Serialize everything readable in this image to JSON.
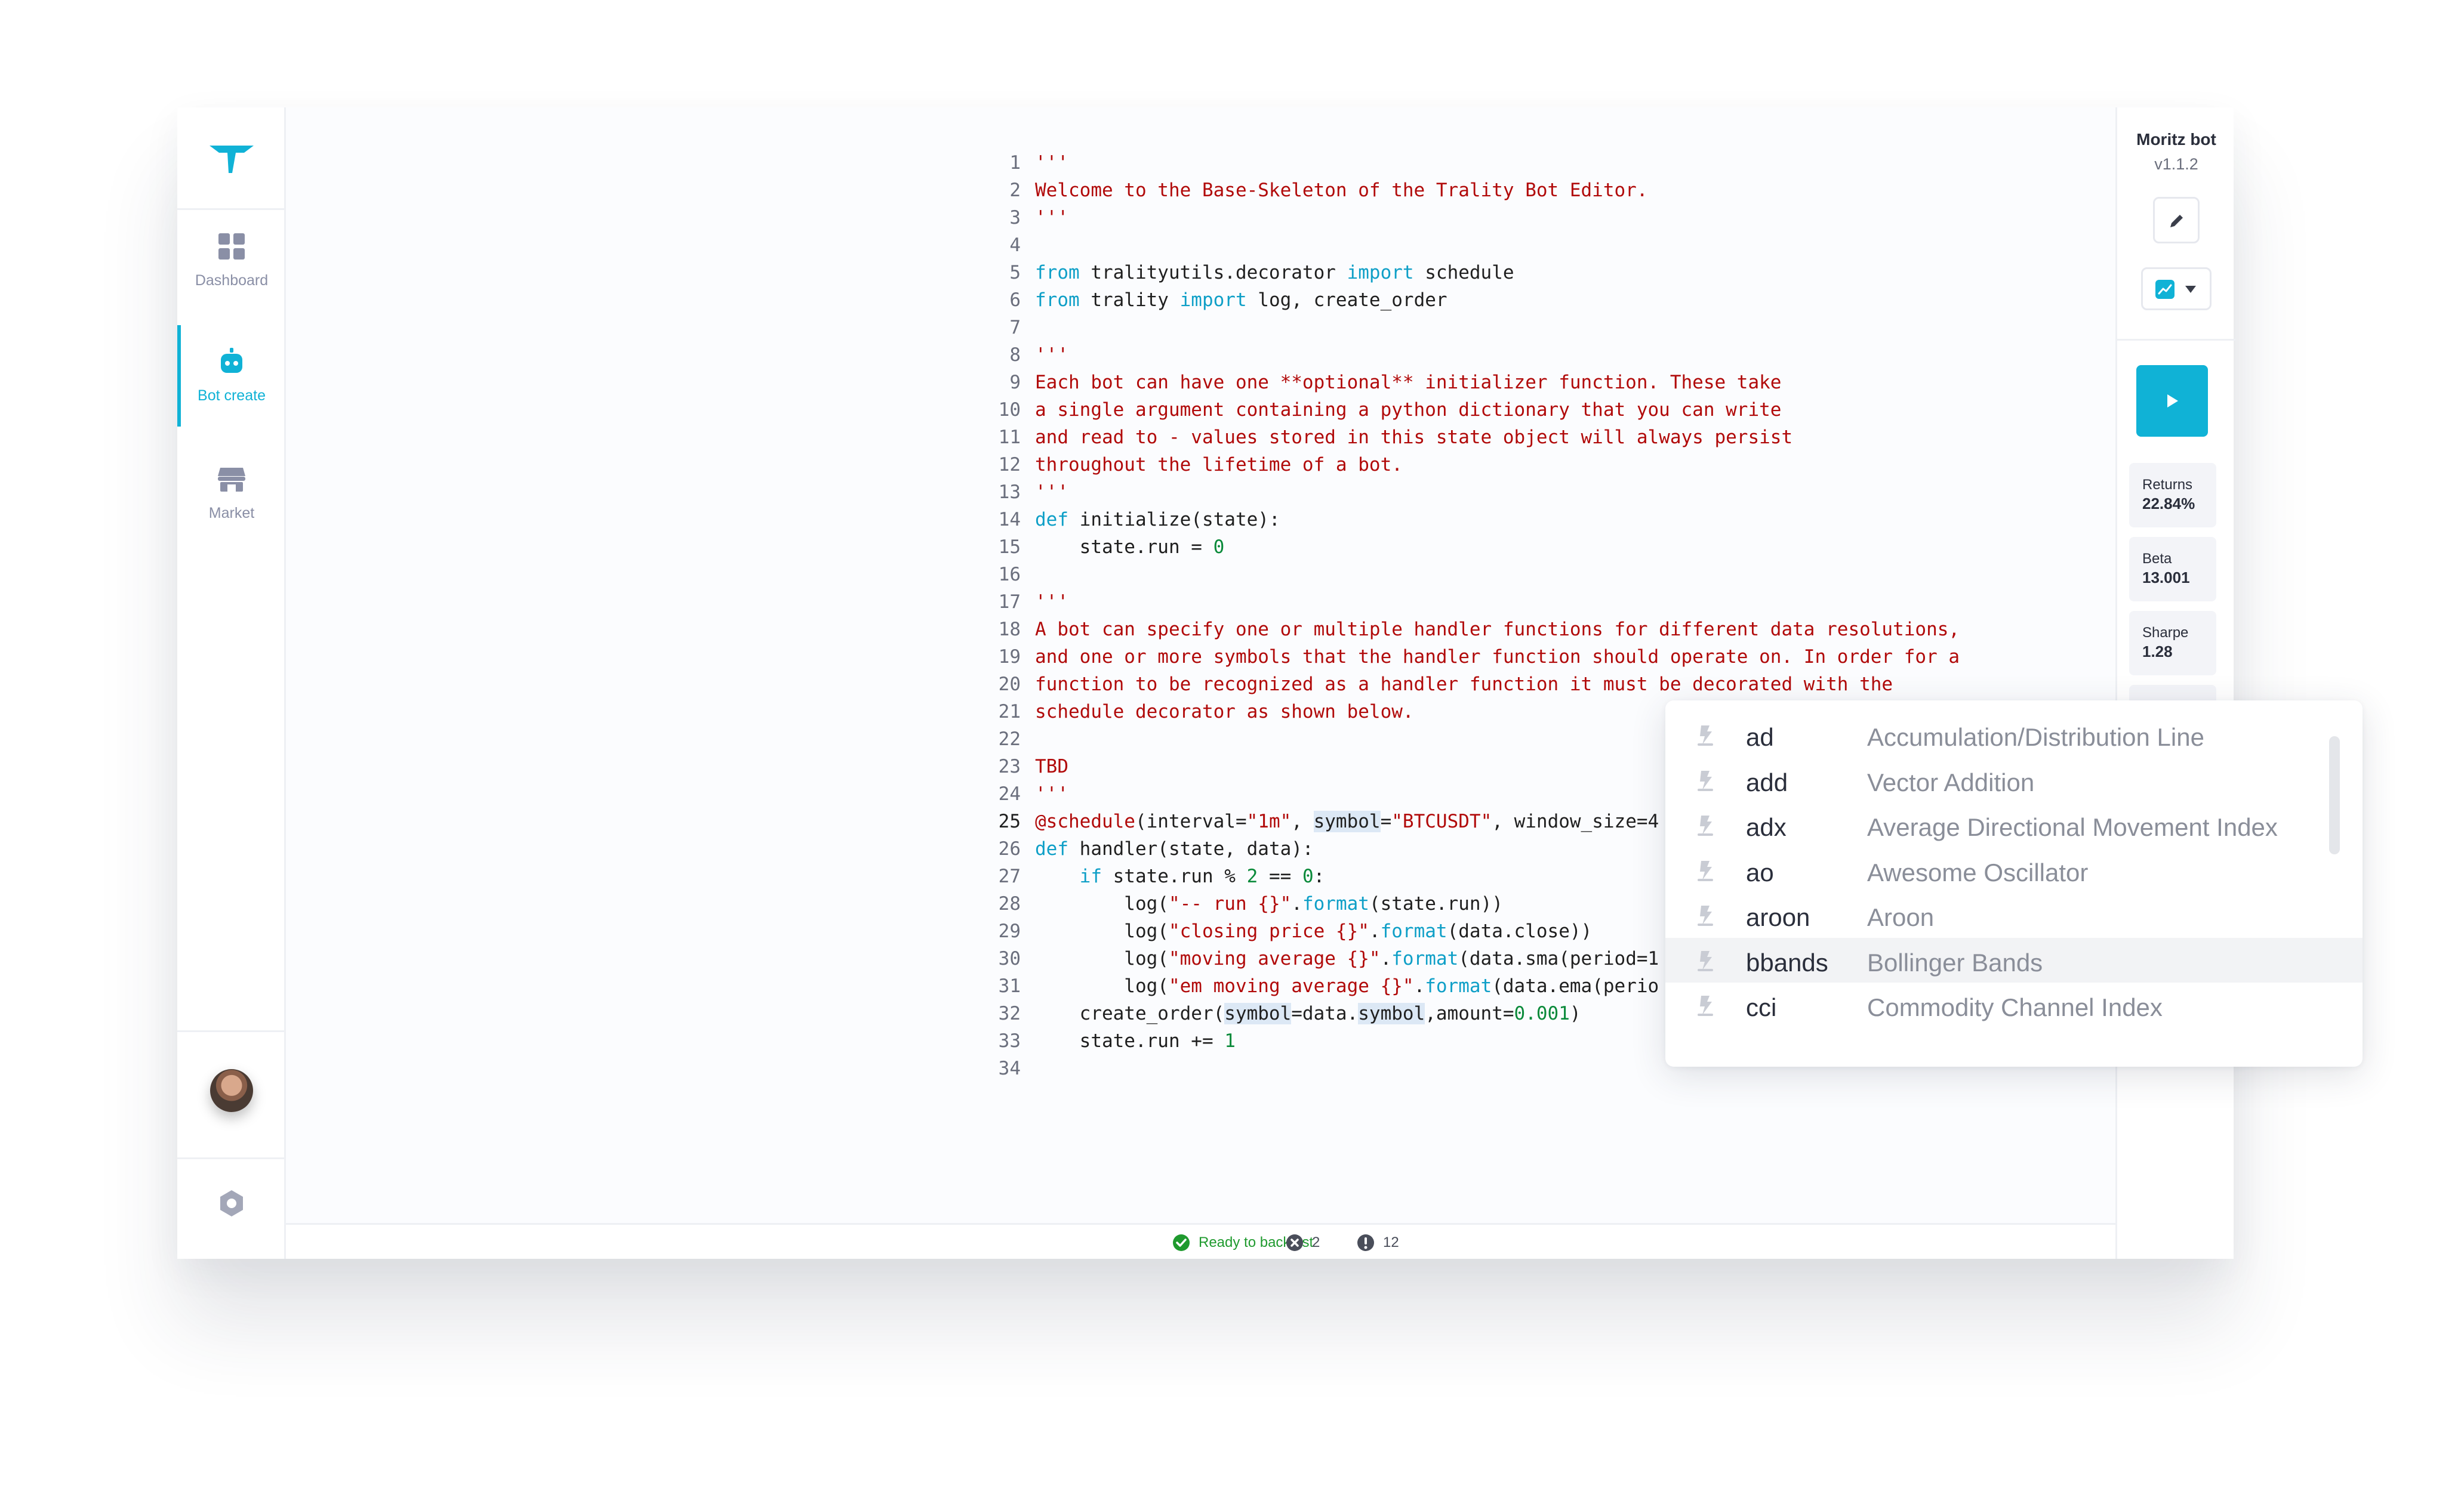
{
  "sidebar": {
    "items": [
      {
        "label": "Dashboard",
        "icon": "grid-icon"
      },
      {
        "label": "Bot create",
        "icon": "robot-icon",
        "active": true
      },
      {
        "label": "Market",
        "icon": "store-icon"
      }
    ]
  },
  "editor": {
    "lines": [
      {
        "n": "1",
        "tokens": [
          {
            "t": "'''",
            "c": "s"
          }
        ]
      },
      {
        "n": "2",
        "tokens": [
          {
            "t": "Welcome to the Base-Skeleton of the Trality Bot Editor.",
            "c": "s"
          }
        ]
      },
      {
        "n": "3",
        "tokens": [
          {
            "t": "'''",
            "c": "s"
          }
        ]
      },
      {
        "n": "4",
        "tokens": []
      },
      {
        "n": "5",
        "tokens": [
          {
            "t": "from",
            "c": "k"
          },
          {
            "t": " tralityutils.decorator "
          },
          {
            "t": "import",
            "c": "k"
          },
          {
            "t": " schedule"
          }
        ]
      },
      {
        "n": "6",
        "tokens": [
          {
            "t": "from",
            "c": "k"
          },
          {
            "t": " trality "
          },
          {
            "t": "import",
            "c": "k"
          },
          {
            "t": " log, create_order"
          }
        ]
      },
      {
        "n": "7",
        "tokens": []
      },
      {
        "n": "8",
        "tokens": [
          {
            "t": "'''",
            "c": "s"
          }
        ]
      },
      {
        "n": "9",
        "tokens": [
          {
            "t": "Each bot can have one **optional** initializer function. These take",
            "c": "s"
          }
        ]
      },
      {
        "n": "10",
        "tokens": [
          {
            "t": "a single argument containing a python dictionary that you can write",
            "c": "s"
          }
        ]
      },
      {
        "n": "11",
        "tokens": [
          {
            "t": "and read to - values stored in this state object will always persist",
            "c": "s"
          }
        ]
      },
      {
        "n": "12",
        "tokens": [
          {
            "t": "throughout the lifetime of a bot.",
            "c": "s"
          }
        ]
      },
      {
        "n": "13",
        "tokens": [
          {
            "t": "'''",
            "c": "s"
          }
        ]
      },
      {
        "n": "14",
        "tokens": [
          {
            "t": "def",
            "c": "k"
          },
          {
            "t": " initialize(state):"
          }
        ]
      },
      {
        "n": "15",
        "tokens": [
          {
            "t": "    state.run = "
          },
          {
            "t": "0",
            "c": "n"
          }
        ]
      },
      {
        "n": "16",
        "tokens": []
      },
      {
        "n": "17",
        "tokens": [
          {
            "t": "'''",
            "c": "s"
          }
        ]
      },
      {
        "n": "18",
        "tokens": [
          {
            "t": "A bot can specify one or multiple handler functions for different data resolutions,",
            "c": "s"
          }
        ]
      },
      {
        "n": "19",
        "tokens": [
          {
            "t": "and one or more symbols that the handler function should operate on. In order for a",
            "c": "s"
          }
        ]
      },
      {
        "n": "20",
        "tokens": [
          {
            "t": "function to be recognized as a handler function it must be decorated with the",
            "c": "s"
          }
        ]
      },
      {
        "n": "21",
        "tokens": [
          {
            "t": "schedule decorator as shown below.",
            "c": "s"
          }
        ]
      },
      {
        "n": "22",
        "tokens": []
      },
      {
        "n": "23",
        "tokens": [
          {
            "t": "TBD",
            "c": "s"
          }
        ]
      },
      {
        "n": "24",
        "tokens": [
          {
            "t": "'''",
            "c": "s"
          }
        ]
      },
      {
        "n": "25",
        "cur": true,
        "tokens": [
          {
            "t": "@schedule",
            "c": "s"
          },
          {
            "t": "(interval="
          },
          {
            "t": "\"1m\"",
            "c": "s"
          },
          {
            "t": ", "
          },
          {
            "t": "symbol",
            "c": "hl"
          },
          {
            "t": "="
          },
          {
            "t": "\"BTCUSDT\"",
            "c": "s"
          },
          {
            "t": ", window_size=4"
          }
        ]
      },
      {
        "n": "26",
        "tokens": [
          {
            "t": "def",
            "c": "k"
          },
          {
            "t": " handler(state, data):"
          }
        ]
      },
      {
        "n": "27",
        "tokens": [
          {
            "t": "    "
          },
          {
            "t": "if",
            "c": "k"
          },
          {
            "t": " state.run % "
          },
          {
            "t": "2",
            "c": "n"
          },
          {
            "t": " == "
          },
          {
            "t": "0",
            "c": "n"
          },
          {
            "t": ":"
          }
        ]
      },
      {
        "n": "28",
        "tokens": [
          {
            "t": "        log("
          },
          {
            "t": "\"-- run {}\"",
            "c": "s"
          },
          {
            "t": "."
          },
          {
            "t": "format",
            "c": "k"
          },
          {
            "t": "(state.run))"
          }
        ]
      },
      {
        "n": "29",
        "tokens": [
          {
            "t": "        log("
          },
          {
            "t": "\"closing price {}\"",
            "c": "s"
          },
          {
            "t": "."
          },
          {
            "t": "format",
            "c": "k"
          },
          {
            "t": "(data.close))"
          }
        ]
      },
      {
        "n": "30",
        "tokens": [
          {
            "t": "        log("
          },
          {
            "t": "\"moving average {}\"",
            "c": "s"
          },
          {
            "t": "."
          },
          {
            "t": "format",
            "c": "k"
          },
          {
            "t": "(data.sma(period=1"
          }
        ]
      },
      {
        "n": "31",
        "tokens": [
          {
            "t": "        log("
          },
          {
            "t": "\"em moving average {}\"",
            "c": "s"
          },
          {
            "t": "."
          },
          {
            "t": "format",
            "c": "k"
          },
          {
            "t": "(data.ema(perio"
          }
        ]
      },
      {
        "n": "32",
        "tokens": [
          {
            "t": "    create_order("
          },
          {
            "t": "symbol",
            "c": "hl"
          },
          {
            "t": "=data."
          },
          {
            "t": "symbol",
            "c": "hl"
          },
          {
            "t": ",amount="
          },
          {
            "t": "0.001",
            "c": "n"
          },
          {
            "t": ")"
          }
        ]
      },
      {
        "n": "33",
        "tokens": [
          {
            "t": "    state.run += "
          },
          {
            "t": "1",
            "c": "n"
          }
        ]
      },
      {
        "n": "34",
        "tokens": []
      }
    ]
  },
  "status": {
    "ready": "Ready to backtest",
    "errors": "2",
    "warnings": "12"
  },
  "panel": {
    "bot_name": "Moritz bot",
    "version": "v1.1.2",
    "metrics": [
      {
        "label": "Returns",
        "value": "22.84%"
      },
      {
        "label": "Beta",
        "value": "13.001"
      },
      {
        "label": "Sharpe",
        "value": "1.28"
      }
    ]
  },
  "autocomplete": {
    "items": [
      {
        "name": "ad",
        "desc": "Accumulation/Distribution Line"
      },
      {
        "name": "add",
        "desc": "Vector Addition"
      },
      {
        "name": "adx",
        "desc": "Average Directional Movement Index"
      },
      {
        "name": "ao",
        "desc": "Awesome Oscillator"
      },
      {
        "name": "aroon",
        "desc": "Aroon"
      },
      {
        "name": "bbands",
        "desc": "Bollinger Bands",
        "selected": true
      },
      {
        "name": "cci",
        "desc": "Commodity Channel Index"
      }
    ]
  },
  "colors": {
    "accent": "#10b2d6",
    "string": "#b10a0a",
    "keyword": "#0e9fc7",
    "number": "#0a8a3a",
    "success": "#1f9a2e"
  }
}
